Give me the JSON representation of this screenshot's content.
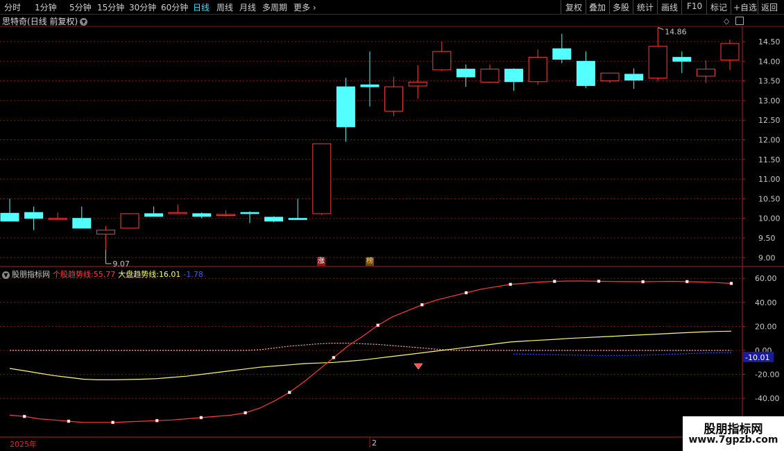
{
  "toolbar": {
    "periods": [
      "分时",
      "1分钟",
      "5分钟",
      "15分钟",
      "30分钟",
      "60分钟",
      "日线",
      "周线",
      "月线",
      "多周期"
    ],
    "active": "日线",
    "more": "更多",
    "right_buttons": [
      "复权",
      "叠加",
      "多股",
      "统计",
      "画线",
      "F10",
      "标记",
      "+自选",
      "返回"
    ]
  },
  "stock": {
    "name": "思特奇",
    "mode": "(日线 前复权)"
  },
  "price_axis": [
    "14.50",
    "14.00",
    "13.50",
    "13.00",
    "12.50",
    "12.00",
    "11.50",
    "11.00",
    "10.50",
    "10.00",
    "9.50",
    "9.00"
  ],
  "candles": [
    {
      "o": 10.13,
      "h": 10.5,
      "l": 9.93,
      "c": 9.93
    },
    {
      "o": 10.15,
      "h": 10.3,
      "l": 9.7,
      "c": 10.0
    },
    {
      "o": 10.0,
      "h": 10.15,
      "l": 9.97,
      "c": 10.0
    },
    {
      "o": 10.0,
      "h": 10.3,
      "l": 9.75,
      "c": 9.75
    },
    {
      "o": 9.6,
      "h": 9.8,
      "l": 9.2,
      "c": 9.7
    },
    {
      "o": 9.75,
      "h": 10.12,
      "l": 9.75,
      "c": 10.12
    },
    {
      "o": 10.12,
      "h": 10.3,
      "l": 10.05,
      "c": 10.05
    },
    {
      "o": 10.12,
      "h": 10.35,
      "l": 10.12,
      "c": 10.15
    },
    {
      "o": 10.12,
      "h": 10.15,
      "l": 10.0,
      "c": 10.05
    },
    {
      "o": 10.1,
      "h": 10.2,
      "l": 10.05,
      "c": 10.1
    },
    {
      "o": 10.15,
      "h": 10.18,
      "l": 9.88,
      "c": 10.12
    },
    {
      "o": 10.03,
      "h": 10.05,
      "l": 9.9,
      "c": 9.93
    },
    {
      "o": 10.0,
      "h": 10.5,
      "l": 9.98,
      "c": 9.97
    },
    {
      "o": 10.12,
      "h": 11.9,
      "l": 10.08,
      "c": 11.9
    },
    {
      "o": 13.35,
      "h": 13.58,
      "l": 11.95,
      "c": 12.33
    },
    {
      "o": 13.4,
      "h": 14.25,
      "l": 12.85,
      "c": 13.35
    },
    {
      "o": 12.73,
      "h": 13.6,
      "l": 12.6,
      "c": 13.35
    },
    {
      "o": 13.37,
      "h": 13.9,
      "l": 13.05,
      "c": 13.47
    },
    {
      "o": 13.78,
      "h": 14.5,
      "l": 13.75,
      "c": 14.25
    },
    {
      "o": 13.8,
      "h": 13.92,
      "l": 13.35,
      "c": 13.6
    },
    {
      "o": 13.47,
      "h": 13.92,
      "l": 13.45,
      "c": 13.8
    },
    {
      "o": 13.8,
      "h": 13.82,
      "l": 13.25,
      "c": 13.48
    },
    {
      "o": 13.48,
      "h": 14.3,
      "l": 13.4,
      "c": 14.1
    },
    {
      "o": 14.32,
      "h": 14.7,
      "l": 13.95,
      "c": 14.05
    },
    {
      "o": 14.0,
      "h": 14.25,
      "l": 13.32,
      "c": 13.38
    },
    {
      "o": 13.5,
      "h": 13.7,
      "l": 13.45,
      "c": 13.7
    },
    {
      "o": 13.67,
      "h": 13.82,
      "l": 13.3,
      "c": 13.52
    },
    {
      "o": 13.57,
      "h": 14.86,
      "l": 13.5,
      "c": 14.38
    },
    {
      "o": 14.1,
      "h": 14.25,
      "l": 13.7,
      "c": 14.0
    },
    {
      "o": 13.62,
      "h": 14.02,
      "l": 13.45,
      "c": 13.8
    },
    {
      "o": 14.03,
      "h": 14.55,
      "l": 13.78,
      "c": 14.45
    }
  ],
  "annotations": {
    "high_label": "14.86",
    "low_label": "9.07"
  },
  "marks": {
    "zhang": "涨",
    "bang": "榜"
  },
  "indicator": {
    "name": "股朋指标网",
    "line1_label": "个股趋势线:",
    "line1_value": "55.77",
    "line2_label": "大盘趋势线:",
    "line2_value": "16.01",
    "line3_value": "-1.78",
    "axis": [
      "60.00",
      "40.00",
      "20.00",
      "0.00",
      "-20.00",
      "-40.00"
    ],
    "current_tag": "-10.01",
    "red_line": [
      -54,
      -55,
      -57,
      -58,
      -59,
      -60,
      -60,
      -60,
      -59.5,
      -59,
      -58.5,
      -58,
      -57,
      -56,
      -55,
      -54,
      -52,
      -48,
      -42,
      -35,
      -26,
      -16,
      -6,
      4,
      12,
      21,
      28,
      33,
      38,
      42,
      45,
      48,
      51,
      53,
      55,
      56,
      57,
      57.5,
      57.8,
      57.8,
      57.6,
      57.4,
      57.3,
      57.2,
      57.4,
      57.5,
      57.3,
      57.0,
      56.5,
      55.8
    ],
    "yellow_line": [
      -15,
      -17,
      -19,
      -21,
      -22.5,
      -24,
      -24.5,
      -24.5,
      -24.3,
      -24,
      -23.5,
      -22.5,
      -21.5,
      -20,
      -18.5,
      -17,
      -15.5,
      -14,
      -13,
      -12,
      -11,
      -10.5,
      -10,
      -9,
      -8,
      -6.5,
      -5,
      -3.5,
      -2,
      -0.5,
      1,
      2.5,
      4,
      5.5,
      7,
      7.8,
      8.5,
      9.2,
      10,
      10.6,
      11.2,
      11.8,
      12.4,
      13,
      13.6,
      14.2,
      14.8,
      15.4,
      15.8,
      16.01
    ],
    "pink_dotted": [
      0,
      0,
      0,
      0,
      0,
      0,
      0,
      0,
      0,
      0,
      0,
      0,
      0,
      0,
      0,
      0,
      0,
      0.5,
      2,
      3.5,
      4.5,
      5.5,
      6,
      6,
      5.5,
      5,
      4,
      3,
      2,
      1,
      0,
      0,
      0,
      0,
      0,
      0,
      0,
      0,
      0,
      0,
      0,
      0,
      0,
      0,
      0,
      0,
      0,
      0,
      0,
      0
    ],
    "blue_dotted": [
      -3,
      -3.2,
      -3.4,
      -3.6,
      -3.8,
      -4,
      -4.2,
      -4.3,
      -4.3,
      -4.1,
      -3.8,
      -3.5,
      -3.0,
      -2.6,
      -2.2,
      -1.9,
      -1.78
    ]
  },
  "time_axis": {
    "year": "2025年",
    "month": "2"
  },
  "watermark": {
    "line1": "股朋指标网",
    "line2": "www.7gpzb.com"
  },
  "colors": {
    "up": "#ff3c3c",
    "down": "#54ffff",
    "yellow": "#ffff66",
    "grid": "#7a1a1a"
  }
}
